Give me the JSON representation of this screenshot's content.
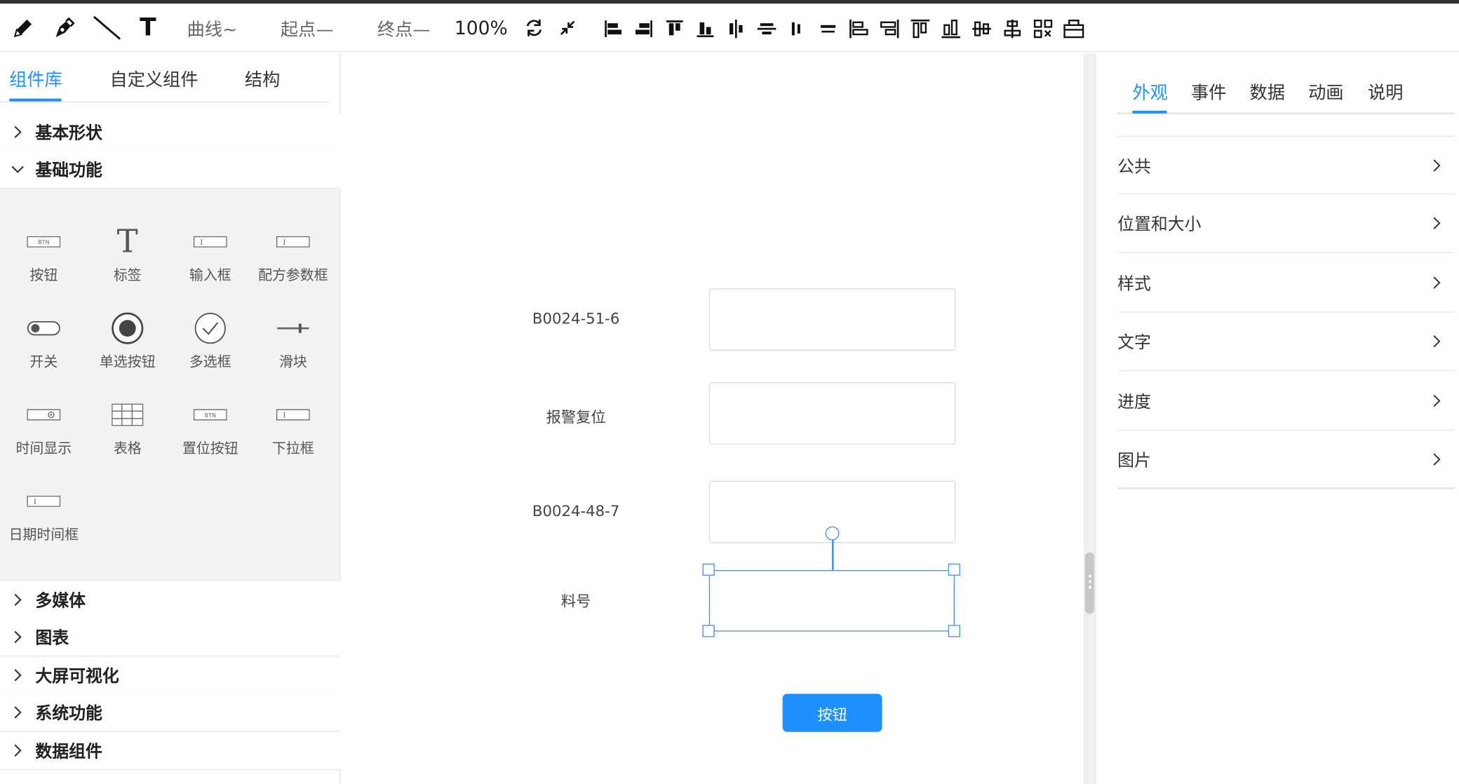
{
  "toolbar": {
    "curve": "曲线~",
    "start": "起点—",
    "end": "终点—",
    "zoom": "100%"
  },
  "left_tabs": [
    "组件库",
    "自定义组件",
    "结构"
  ],
  "sections_top": [
    "基本形状",
    "基础功能"
  ],
  "components": [
    {
      "label": "按钮",
      "icon": "button-icon"
    },
    {
      "label": "标签",
      "icon": "text-label-icon"
    },
    {
      "label": "输入框",
      "icon": "input-icon"
    },
    {
      "label": "配方参数框",
      "icon": "recipe-input-icon"
    },
    {
      "label": "开关",
      "icon": "toggle-icon"
    },
    {
      "label": "单选按钮",
      "icon": "radio-icon"
    },
    {
      "label": "多选框",
      "icon": "checkbox-icon"
    },
    {
      "label": "滑块",
      "icon": "slider-icon"
    },
    {
      "label": "时间显示",
      "icon": "time-display-icon"
    },
    {
      "label": "表格",
      "icon": "table-icon"
    },
    {
      "label": "置位按钮",
      "icon": "set-button-icon"
    },
    {
      "label": "下拉框",
      "icon": "dropdown-icon"
    },
    {
      "label": "日期时间框",
      "icon": "datetime-icon"
    }
  ],
  "sections_bottom": [
    "多媒体",
    "图表",
    "大屏可视化",
    "系统功能",
    "数据组件"
  ],
  "canvas": {
    "fields": [
      "B0024-51-6",
      "报警复位",
      "B0024-48-7",
      "料号"
    ],
    "button": "按钮"
  },
  "right_tabs": [
    "外观",
    "事件",
    "数据",
    "动画",
    "说明"
  ],
  "props": [
    "公共",
    "位置和大小",
    "样式",
    "文字",
    "进度",
    "图片"
  ],
  "colors": {
    "accent": "#1e90ff",
    "selection": "#4a90e2"
  }
}
